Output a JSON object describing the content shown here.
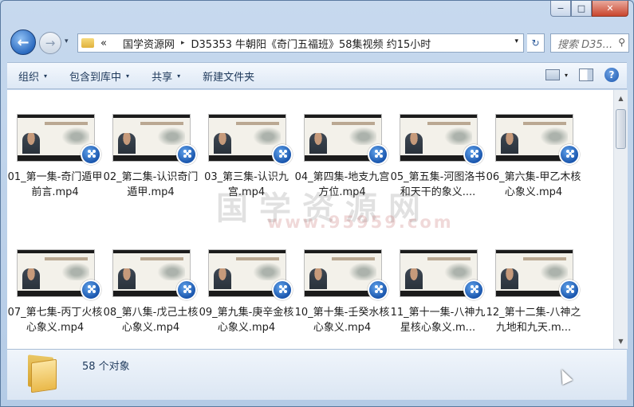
{
  "window": {
    "minimize": "−",
    "maximize": "□",
    "close": "✕"
  },
  "nav": {
    "back": "←",
    "forward": "→",
    "history": "▾",
    "breadcrumb_overflow": "«",
    "breadcrumbs": [
      "国学资源网",
      "D35353 牛朝阳《奇门五福班》58集视频 约15小时"
    ],
    "separator": "▸",
    "dropdown": "▾",
    "refresh": "↻",
    "search_placeholder": "搜索 D35..."
  },
  "toolbar": {
    "organize": "组织",
    "include_in_library": "包含到库中",
    "share": "共享",
    "new_folder": "新建文件夹",
    "caret": "▾",
    "help": "?"
  },
  "files": [
    "01_第一集-奇门遁甲前言.mp4",
    "02_第二集-认识奇门遁甲.mp4",
    "03_第三集-认识九宫.mp4",
    "04_第四集-地支九宫方位.mp4",
    "05_第五集-河图洛书和天干的象义....",
    "06_第六集-甲乙木核心象义.mp4",
    "07_第七集-丙丁火核心象义.mp4",
    "08_第八集-戊己土核心象义.mp4",
    "09_第九集-庚辛金核心象义.mp4",
    "10_第十集-壬癸水核心象义.mp4",
    "11_第十一集-八神九星核心象义.m...",
    "12_第十二集-八神之九地和九天.m..."
  ],
  "watermark": {
    "text": "国学资源网",
    "url": "www.95959.com"
  },
  "status": {
    "count": "58 个对象"
  },
  "scrollbar": {
    "up": "▲",
    "down": "▼"
  }
}
